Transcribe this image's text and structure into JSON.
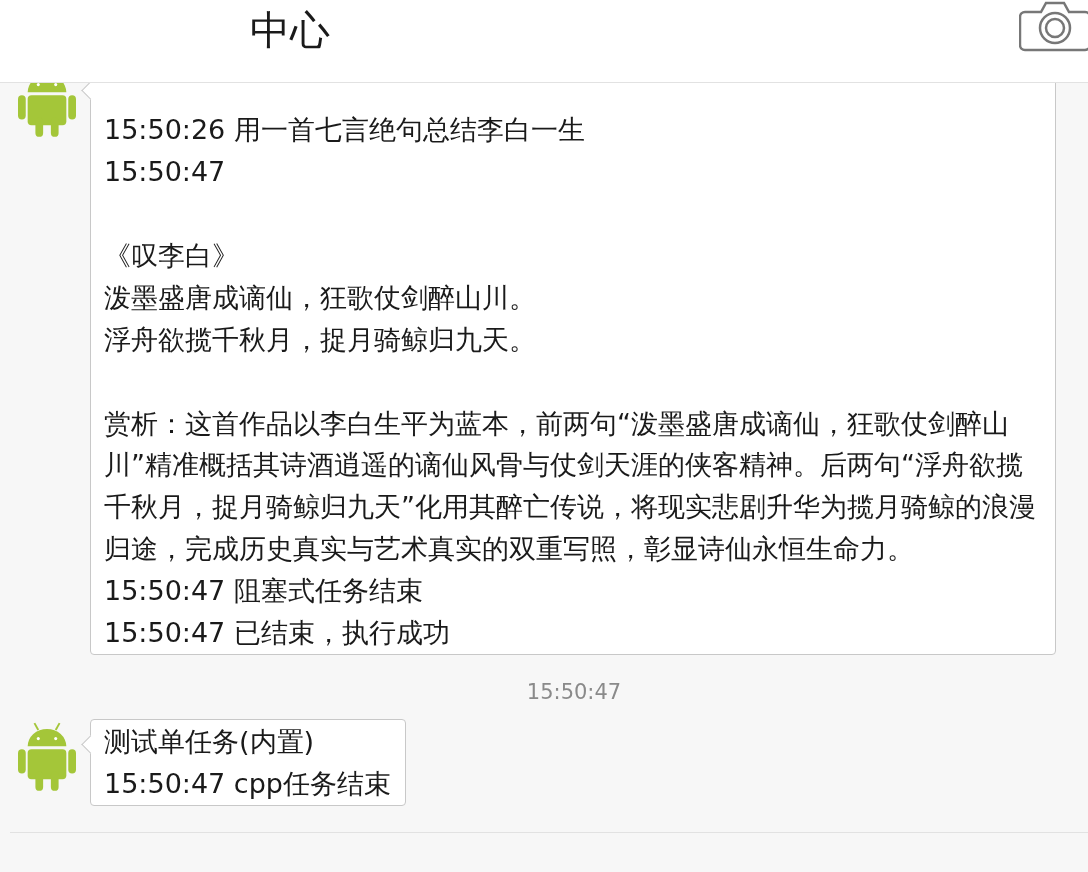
{
  "header": {
    "title": "中心"
  },
  "messages": [
    {
      "kind": "bubble",
      "blocks": [
        [
          "15:50:26 用一首七言绝句总结李白一生",
          "15:50:47"
        ],
        [
          "《叹李白》",
          "泼墨盛唐成谪仙，狂歌仗剑醉山川。",
          "浮舟欲揽千秋月，捉月骑鲸归九天。"
        ],
        [
          "赏析：这首作品以李白生平为蓝本，前两句“泼墨盛唐成谪仙，狂歌仗剑醉山川”精准概括其诗酒逍遥的谪仙风骨与仗剑天涯的侠客精神。后两句“浮舟欲揽千秋月，捉月骑鲸归九天”化用其醉亡传说，将现实悲剧升华为揽月骑鲸的浪漫归途，完成历史真实与艺术真实的双重写照，彰显诗仙永恒生命力。",
          "15:50:47 阻塞式任务结束",
          "15:50:47 已结束，执行成功"
        ]
      ]
    },
    {
      "kind": "timestamp",
      "text": "15:50:47"
    },
    {
      "kind": "bubble",
      "blocks": [
        [
          "测试单任务(内置)",
          "15:50:47 cpp任务结束"
        ]
      ]
    }
  ]
}
